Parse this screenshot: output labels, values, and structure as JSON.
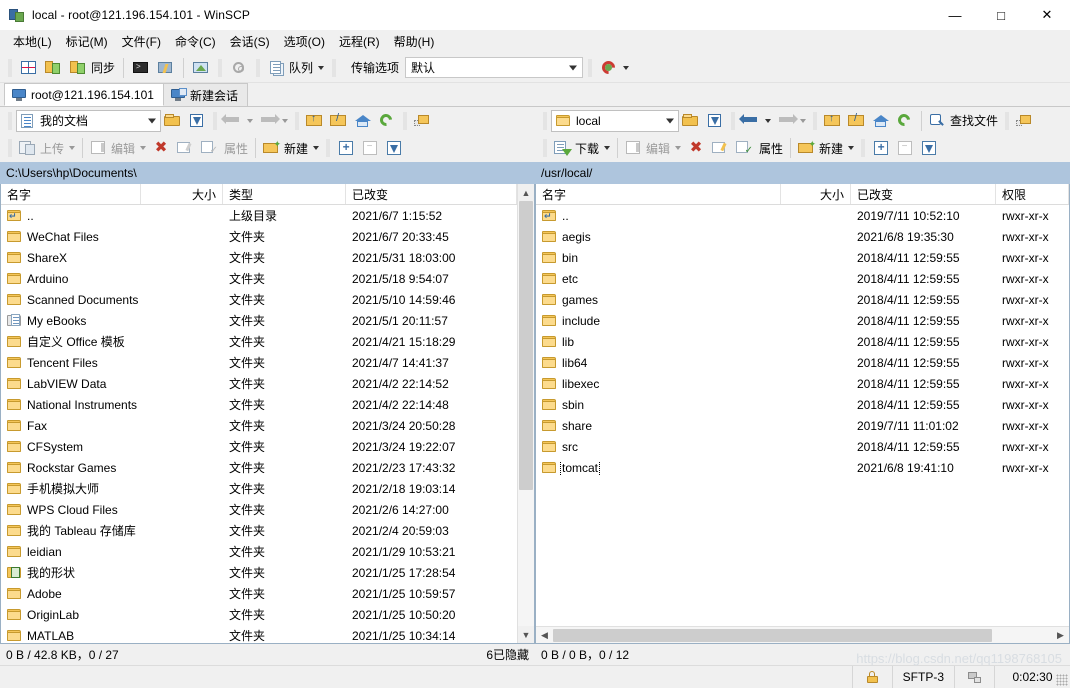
{
  "window": {
    "title": "local - root@121.196.154.101 - WinSCP",
    "minimize": "—",
    "maximize": "□",
    "close": "✕"
  },
  "menubar": [
    {
      "label": "本地(L)"
    },
    {
      "label": "标记(M)"
    },
    {
      "label": "文件(F)"
    },
    {
      "label": "命令(C)"
    },
    {
      "label": "会话(S)"
    },
    {
      "label": "选项(O)"
    },
    {
      "label": "远程(R)"
    },
    {
      "label": "帮助(H)"
    }
  ],
  "toolbar": {
    "sync_label": "同步",
    "queue_label": "队列",
    "transfer_label": "传输选项",
    "transfer_value": "默认"
  },
  "tabs": [
    {
      "label": "root@121.196.154.101",
      "active": true
    },
    {
      "label": "新建会话",
      "active": false
    }
  ],
  "left_panel": {
    "combo_value": "我的文档",
    "path": "C:\\Users\\hp\\Documents\\",
    "buttons": {
      "upload": "上传",
      "edit": "编辑",
      "properties": "属性",
      "new": "新建"
    },
    "columns": [
      "名字",
      "大小",
      "类型",
      "已改变"
    ],
    "rows": [
      {
        "name": "..",
        "icon": "folder-up",
        "size": "",
        "type": "上级目录",
        "changed": "2021/6/7  1:15:52"
      },
      {
        "name": "WeChat Files",
        "icon": "folder",
        "size": "",
        "type": "文件夹",
        "changed": "2021/6/7  20:33:45"
      },
      {
        "name": "ShareX",
        "icon": "folder",
        "size": "",
        "type": "文件夹",
        "changed": "2021/5/31  18:03:00"
      },
      {
        "name": "Arduino",
        "icon": "folder",
        "size": "",
        "type": "文件夹",
        "changed": "2021/5/18  9:54:07"
      },
      {
        "name": "Scanned Documents",
        "icon": "folder",
        "size": "",
        "type": "文件夹",
        "changed": "2021/5/10  14:59:46"
      },
      {
        "name": "My eBooks",
        "icon": "folder-doc",
        "size": "",
        "type": "文件夹",
        "changed": "2021/5/1  20:11:57"
      },
      {
        "name": "自定义 Office 模板",
        "icon": "folder",
        "size": "",
        "type": "文件夹",
        "changed": "2021/4/21  15:18:29"
      },
      {
        "name": "Tencent Files",
        "icon": "folder",
        "size": "",
        "type": "文件夹",
        "changed": "2021/4/7  14:41:37"
      },
      {
        "name": "LabVIEW Data",
        "icon": "folder",
        "size": "",
        "type": "文件夹",
        "changed": "2021/4/2  22:14:52"
      },
      {
        "name": "National Instruments",
        "icon": "folder",
        "size": "",
        "type": "文件夹",
        "changed": "2021/4/2  22:14:48"
      },
      {
        "name": "Fax",
        "icon": "folder",
        "size": "",
        "type": "文件夹",
        "changed": "2021/3/24  20:50:28"
      },
      {
        "name": "CFSystem",
        "icon": "folder",
        "size": "",
        "type": "文件夹",
        "changed": "2021/3/24  19:22:07"
      },
      {
        "name": "Rockstar Games",
        "icon": "folder",
        "size": "",
        "type": "文件夹",
        "changed": "2021/2/23  17:43:32"
      },
      {
        "name": "手机模拟大师",
        "icon": "folder",
        "size": "",
        "type": "文件夹",
        "changed": "2021/2/18  19:03:14"
      },
      {
        "name": "WPS Cloud Files",
        "icon": "folder",
        "size": "",
        "type": "文件夹",
        "changed": "2021/2/6  14:27:00"
      },
      {
        "name": "我的 Tableau 存储库",
        "icon": "folder",
        "size": "",
        "type": "文件夹",
        "changed": "2021/2/4  20:59:03"
      },
      {
        "name": "leidian",
        "icon": "folder",
        "size": "",
        "type": "文件夹",
        "changed": "2021/1/29  10:53:21"
      },
      {
        "name": "我的形状",
        "icon": "folder-green",
        "size": "",
        "type": "文件夹",
        "changed": "2021/1/25  17:28:54"
      },
      {
        "name": "Adobe",
        "icon": "folder",
        "size": "",
        "type": "文件夹",
        "changed": "2021/1/25  10:59:57"
      },
      {
        "name": "OriginLab",
        "icon": "folder",
        "size": "",
        "type": "文件夹",
        "changed": "2021/1/25  10:50:20"
      },
      {
        "name": "MATLAB",
        "icon": "folder",
        "size": "",
        "type": "文件夹",
        "changed": "2021/1/25  10:34:14"
      }
    ],
    "status": "0 B / 42.8 KB，0 / 27",
    "hidden": "6已隐藏"
  },
  "right_panel": {
    "combo_value": "local",
    "path": "/usr/local/",
    "buttons": {
      "download": "下载",
      "edit": "编辑",
      "properties": "属性",
      "new": "新建",
      "find": "查找文件"
    },
    "columns": [
      "名字",
      "大小",
      "已改变",
      "权限"
    ],
    "rows": [
      {
        "name": "..",
        "icon": "folder-up",
        "size": "",
        "changed": "2019/7/11 10:52:10",
        "perm": "rwxr-xr-x",
        "focus": false
      },
      {
        "name": "aegis",
        "icon": "folder",
        "size": "",
        "changed": "2021/6/8 19:35:30",
        "perm": "rwxr-xr-x",
        "focus": false
      },
      {
        "name": "bin",
        "icon": "folder",
        "size": "",
        "changed": "2018/4/11 12:59:55",
        "perm": "rwxr-xr-x",
        "focus": false
      },
      {
        "name": "etc",
        "icon": "folder",
        "size": "",
        "changed": "2018/4/11 12:59:55",
        "perm": "rwxr-xr-x",
        "focus": false
      },
      {
        "name": "games",
        "icon": "folder",
        "size": "",
        "changed": "2018/4/11 12:59:55",
        "perm": "rwxr-xr-x",
        "focus": false
      },
      {
        "name": "include",
        "icon": "folder",
        "size": "",
        "changed": "2018/4/11 12:59:55",
        "perm": "rwxr-xr-x",
        "focus": false
      },
      {
        "name": "lib",
        "icon": "folder",
        "size": "",
        "changed": "2018/4/11 12:59:55",
        "perm": "rwxr-xr-x",
        "focus": false
      },
      {
        "name": "lib64",
        "icon": "folder",
        "size": "",
        "changed": "2018/4/11 12:59:55",
        "perm": "rwxr-xr-x",
        "focus": false
      },
      {
        "name": "libexec",
        "icon": "folder",
        "size": "",
        "changed": "2018/4/11 12:59:55",
        "perm": "rwxr-xr-x",
        "focus": false
      },
      {
        "name": "sbin",
        "icon": "folder",
        "size": "",
        "changed": "2018/4/11 12:59:55",
        "perm": "rwxr-xr-x",
        "focus": false
      },
      {
        "name": "share",
        "icon": "folder",
        "size": "",
        "changed": "2019/7/11 11:01:02",
        "perm": "rwxr-xr-x",
        "focus": false
      },
      {
        "name": "src",
        "icon": "folder",
        "size": "",
        "changed": "2018/4/11 12:59:55",
        "perm": "rwxr-xr-x",
        "focus": false
      },
      {
        "name": "tomcat",
        "icon": "folder",
        "size": "",
        "changed": "2021/6/8 19:41:10",
        "perm": "rwxr-xr-x",
        "focus": true
      }
    ],
    "status": "0 B / 0 B，0 / 12"
  },
  "statusbar": {
    "protocol": "SFTP-3",
    "duration": "0:02:30"
  },
  "watermark": "https://blog.csdn.net/qq1198768105"
}
